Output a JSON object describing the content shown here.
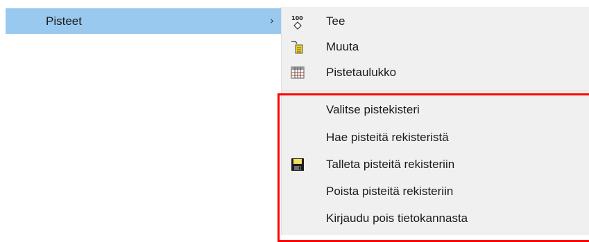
{
  "parent_menu": {
    "item_label": "Pisteet",
    "chevron": "›"
  },
  "submenu": {
    "items": [
      {
        "label": "Tee",
        "icon": "points-100-icon"
      },
      {
        "label": "Muuta",
        "icon": "edit-points-icon"
      },
      {
        "label": "Pistetaulukko",
        "icon": "table-icon"
      },
      {
        "label": "Valitse pistekisteri",
        "icon": ""
      },
      {
        "label": "Hae pisteitä rekisteristä",
        "icon": ""
      },
      {
        "label": "Talleta pisteitä rekisteriin",
        "icon": "save-floppy-icon"
      },
      {
        "label": "Poista pisteitä rekisteriin",
        "icon": ""
      },
      {
        "label": "Kirjaudu pois tietokannasta",
        "icon": ""
      }
    ]
  },
  "icon_texts": {
    "hundred": "100"
  },
  "colors": {
    "selected_bg": "#99c9ef",
    "highlight_border": "#ff0000"
  }
}
